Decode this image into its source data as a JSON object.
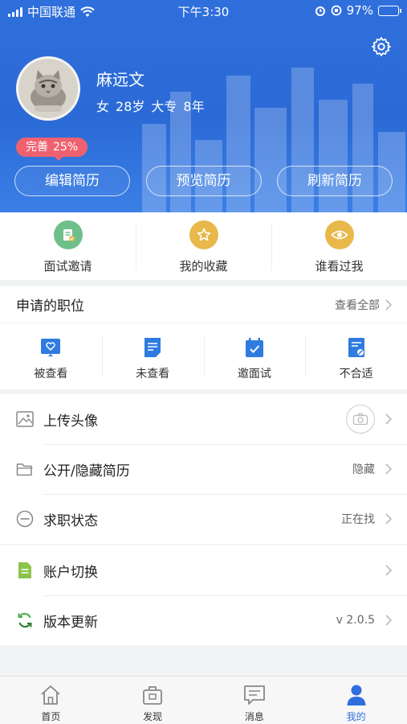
{
  "status_bar": {
    "carrier": "中国联通",
    "time": "下午3:30",
    "battery": "97%"
  },
  "profile": {
    "name": "麻远文",
    "gender": "女",
    "age": "28岁",
    "education": "大专",
    "experience": "8年",
    "completion_label": "完善",
    "completion_value": "25%"
  },
  "header_buttons": [
    "编辑简历",
    "预览简历",
    "刷新简历"
  ],
  "quick_actions": [
    {
      "label": "面试邀请",
      "icon": "interview-invite-icon",
      "color": "#6fbf8a"
    },
    {
      "label": "我的收藏",
      "icon": "star-icon",
      "color": "#e8b84a"
    },
    {
      "label": "谁看过我",
      "icon": "eye-icon",
      "color": "#e8b84a"
    }
  ],
  "applied": {
    "title": "申请的职位",
    "see_all": "查看全部",
    "items": [
      {
        "label": "被查看",
        "icon": "heart-doc-icon"
      },
      {
        "label": "未查看",
        "icon": "doc-lines-icon"
      },
      {
        "label": "邀面试",
        "icon": "calendar-check-icon"
      },
      {
        "label": "不合适",
        "icon": "doc-reject-icon"
      }
    ]
  },
  "menu_group_1": [
    {
      "label": "上传头像",
      "value": "",
      "icon": "image-icon"
    },
    {
      "label": "公开/隐藏简历",
      "value": "隐藏",
      "icon": "folder-icon"
    },
    {
      "label": "求职状态",
      "value": "正在找",
      "icon": "minus-circle-icon"
    }
  ],
  "menu_group_2": [
    {
      "label": "账户切换",
      "value": "",
      "icon": "account-doc-icon"
    },
    {
      "label": "版本更新",
      "value": "v 2.0.5",
      "icon": "refresh-icon"
    }
  ],
  "tabbar": [
    {
      "label": "首页",
      "icon": "home-icon",
      "active": false
    },
    {
      "label": "发现",
      "icon": "briefcase-icon",
      "active": false
    },
    {
      "label": "消息",
      "icon": "message-icon",
      "active": false
    },
    {
      "label": "我的",
      "icon": "person-icon",
      "active": true
    }
  ],
  "colors": {
    "primary": "#2f6fdc",
    "badge": "#f0616f",
    "green": "#8bc34a"
  }
}
